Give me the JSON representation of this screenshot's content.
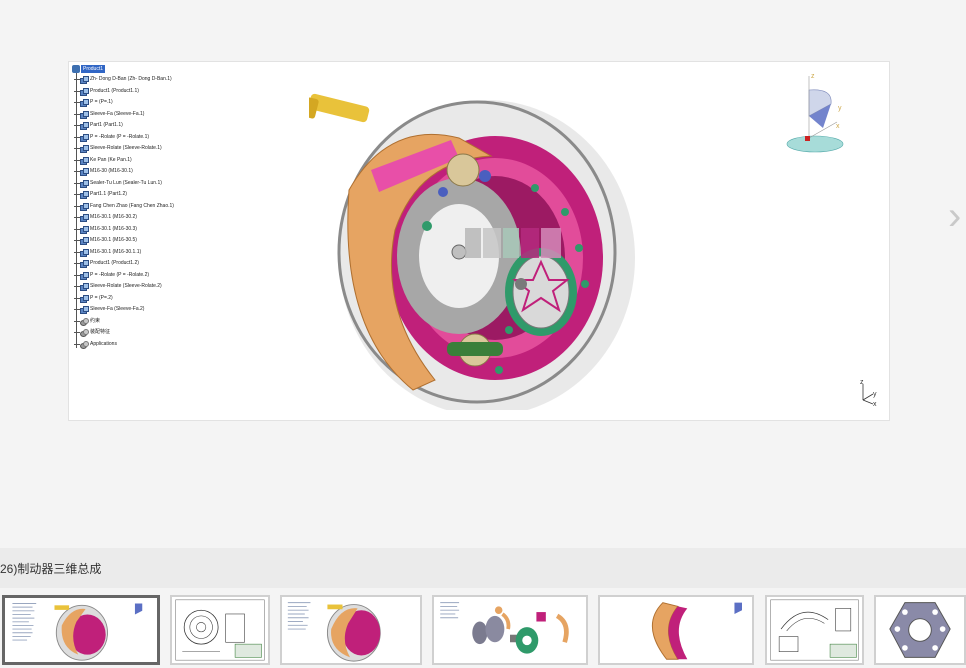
{
  "viewer": {
    "tree": {
      "root": "Product1",
      "items": [
        "Zh- Dong D-Ban (Zh- Dong D-Ban.1)",
        "Product1 (Product1.1)",
        "P = (P=.1)",
        "Sleeve-Fa (Sleeve-Fa.1)",
        "Part1 (Part1.1)",
        "P = -Rolate (P = -Rolate.1)",
        "Sleeve-Rolate (Sleeve-Rolate.1)",
        "Ke Pan (Ke Pan.1)",
        "M16-30 (M16-30.1)",
        "Sealer-Tu Lun (Sealer-Tu Lun.1)",
        "Part1.1 (Part1.2)",
        "Fang Chen Zhao (Fang Chen Zhao.1)",
        "M16-30.1 (M16-30.2)",
        "M16-30.1 (M16-30.3)",
        "M16-30.1 (M16-30.5)",
        "M16-30.1 (M16-30.1.1)",
        "Product1 (Product1.2)",
        "P = -Rolate (P = -Rolate.2)",
        "Sleeve-Rolate (Sleeve-Rolate.2)",
        "P = (P=.2)",
        "Sleeve-Fa (Sleeve-Fa.2)",
        "约束",
        "装配特征",
        "Applications"
      ]
    },
    "axis_labels": {
      "z": "z",
      "y": "y",
      "x": "x"
    },
    "compass_labels": {
      "z": "z",
      "y": "y",
      "x": "x"
    },
    "next_arrow": "›"
  },
  "caption": "26)制动器三维总成",
  "thumbnails": [
    {
      "name": "thumb-assembly-1",
      "active": true
    },
    {
      "name": "thumb-drawing-1",
      "active": false
    },
    {
      "name": "thumb-assembly-2",
      "active": false
    },
    {
      "name": "thumb-exploded",
      "active": false
    },
    {
      "name": "thumb-brake-shoe",
      "active": false
    },
    {
      "name": "thumb-drawing-2",
      "active": false
    },
    {
      "name": "thumb-plate",
      "active": false
    }
  ],
  "colors": {
    "magenta": "#c0207a",
    "orange": "#e6a462",
    "gold": "#e9c23a",
    "green": "#2f9a6a",
    "selection_blue": "#3166c5"
  }
}
